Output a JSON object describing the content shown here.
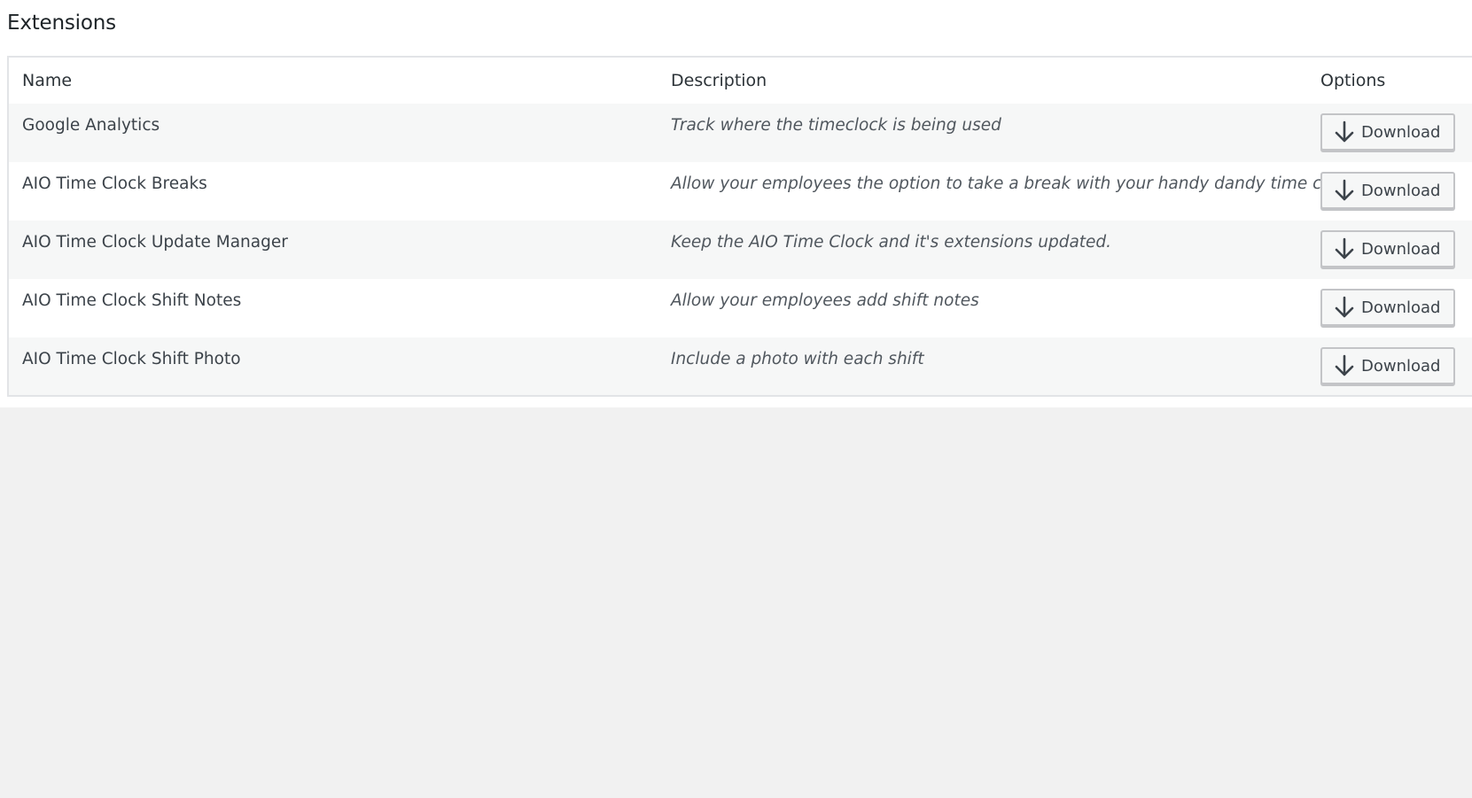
{
  "page": {
    "title": "Extensions"
  },
  "table": {
    "columns": [
      "Name",
      "Description",
      "Options"
    ],
    "rows": [
      {
        "name": "Google Analytics",
        "description": "Track where the timeclock is being used",
        "action_label": "Download",
        "action_icon": "download-icon"
      },
      {
        "name": "AIO Time Clock Breaks",
        "description": "Allow your employees the option to take a break with your handy dandy time clock",
        "action_label": "Download",
        "action_icon": "download-icon"
      },
      {
        "name": "AIO Time Clock Update Manager",
        "description": "Keep the AIO Time Clock and it's extensions updated.",
        "action_label": "Download",
        "action_icon": "download-icon"
      },
      {
        "name": "AIO Time Clock Shift Notes",
        "description": "Allow your employees add shift notes",
        "action_label": "Download",
        "action_icon": "download-icon"
      },
      {
        "name": "AIO Time Clock Shift Photo",
        "description": "Include a photo with each shift",
        "action_label": "Download",
        "action_icon": "download-icon"
      }
    ]
  },
  "colors": {
    "panel_background": "#ffffff",
    "page_background": "#f1f1f1",
    "row_stripe": "#f6f7f7",
    "button_border": "#c3c4c7"
  }
}
